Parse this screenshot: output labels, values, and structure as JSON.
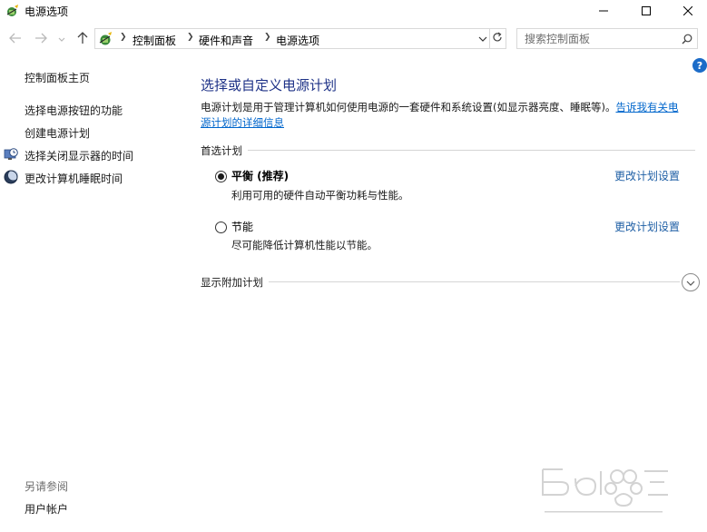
{
  "window": {
    "title": "电源选项"
  },
  "address": {
    "crumbs": [
      "控制面板",
      "硬件和声音",
      "电源选项"
    ]
  },
  "search": {
    "placeholder": "搜索控制面板"
  },
  "help": {
    "label": "?"
  },
  "left": {
    "home": "控制面板主页",
    "links": [
      {
        "label": "选择电源按钮的功能",
        "icon": null
      },
      {
        "label": "创建电源计划",
        "icon": null
      },
      {
        "label": "选择关闭显示器的时间",
        "icon": "clock-monitor-icon"
      },
      {
        "label": "更改计算机睡眠时间",
        "icon": "moon-icon"
      }
    ],
    "see_also": "另请参阅",
    "user_accounts": "用户帐户"
  },
  "main": {
    "title": "选择或自定义电源计划",
    "desc_text": "电源计划是用于管理计算机如何使用电源的一套硬件和系统设置(如显示器亮度、睡眠等)。",
    "desc_link_1": "告诉我有关电",
    "desc_link_2": "源计划的详细信息",
    "preferred_label": "首选计划",
    "plans": [
      {
        "name": "平衡 (推荐)",
        "desc": "利用可用的硬件自动平衡功耗与性能。",
        "selected": true,
        "link": "更改计划设置"
      },
      {
        "name": "节能",
        "desc": "尽可能降低计算机性能以节能。",
        "selected": false,
        "link": "更改计划设置"
      }
    ],
    "additional_label": "显示附加计划"
  },
  "colors": {
    "title_blue": "#1e3287",
    "link_blue": "#1f5fa5",
    "help_blue": "#1c6cc8"
  }
}
